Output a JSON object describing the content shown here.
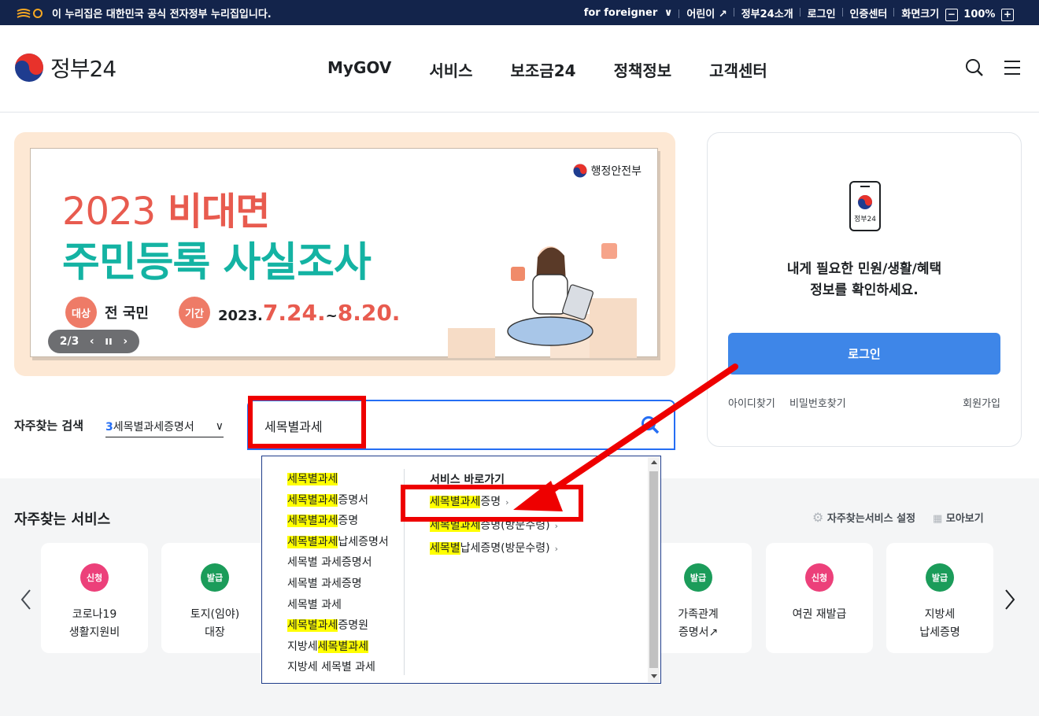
{
  "topbar": {
    "notice": "이 누리집은 대한민국 공식 전자정부 누리집입니다.",
    "links": [
      "for foreigner",
      "어린이",
      "정부24소개",
      "로그인",
      "인증센터",
      "화면크기"
    ],
    "zoom_minus": "−",
    "zoom_value": "100%",
    "zoom_plus": "+"
  },
  "header": {
    "logo_text": "정부24",
    "nav": [
      "MyGOV",
      "서비스",
      "보조금24",
      "정책정보",
      "고객센터"
    ]
  },
  "banner": {
    "ministry": "행정안전부",
    "year": "2023",
    "title_line1": "비대면",
    "title_line2": "주민등록 사실조사",
    "target_badge": "대상",
    "target_value": "전 국민",
    "period_badge": "기간",
    "period_prefix": "2023.",
    "period_start": "7.24.",
    "period_sep": "~",
    "period_end": "8.20.",
    "pager_text": "2/3"
  },
  "login_panel": {
    "app_label": "정부24",
    "message_line1": "내게 필요한 민원/생활/혜택",
    "message_line2": "정보를 확인하세요.",
    "login_button": "로그인",
    "find_id": "아이디찾기",
    "find_pw": "비밀번호찾기",
    "join": "회원가입"
  },
  "search": {
    "frequent_label": "자주찾는 검색",
    "frequent_rank": "3",
    "frequent_term": "세목별과세증명서",
    "query": "세목별과세"
  },
  "autocomplete": {
    "suggestions": [
      {
        "hl": "세목별과세",
        "rest": ""
      },
      {
        "hl": "세목별과세",
        "rest": "증명서"
      },
      {
        "hl": "세목별과세",
        "rest": "증명"
      },
      {
        "hl": "세목별과세",
        "rest": "납세증명서"
      },
      {
        "hl": "",
        "rest": "세목별 과세증명서"
      },
      {
        "hl": "",
        "rest": "세목별 과세증명"
      },
      {
        "hl": "",
        "rest": "세목별 과세"
      },
      {
        "hl": "세목별과세",
        "rest": "증명원"
      },
      {
        "pre": "지방세",
        "hl": "세목별과세",
        "rest": ""
      },
      {
        "hl": "",
        "rest": "지방세 세목별 과세"
      }
    ],
    "shortcut_heading": "서비스 바로가기",
    "shortcuts": [
      {
        "hl": "세목별과세",
        "rest": "증명"
      },
      {
        "hl": "세목별과세",
        "rest": "증명(방문수령)"
      },
      {
        "hl": "세목별",
        "rest": "납세증명(방문수령)"
      }
    ]
  },
  "frequent_services": {
    "title": "자주찾는 서비스",
    "settings": "자주찾는서비스 설정",
    "view_all": "모아보기",
    "cards": [
      {
        "badge": "신청",
        "line1": "코로나19",
        "line2": "생활지원비"
      },
      {
        "badge": "발급",
        "line1": "토지(임야)",
        "line2": "대장"
      },
      {
        "badge": "발급",
        "line1": "가족관계",
        "line2": "증명서"
      },
      {
        "badge": "신청",
        "line1": "여권 재발급",
        "line2": ""
      },
      {
        "badge": "발급",
        "line1": "지방세",
        "line2": "납세증명"
      }
    ]
  },
  "colors": {
    "topbar": "#13244b",
    "primary": "#256ef4",
    "login_button": "#3e86e8",
    "annotation_red": "#ee0000",
    "highlight": "#ffff00"
  }
}
